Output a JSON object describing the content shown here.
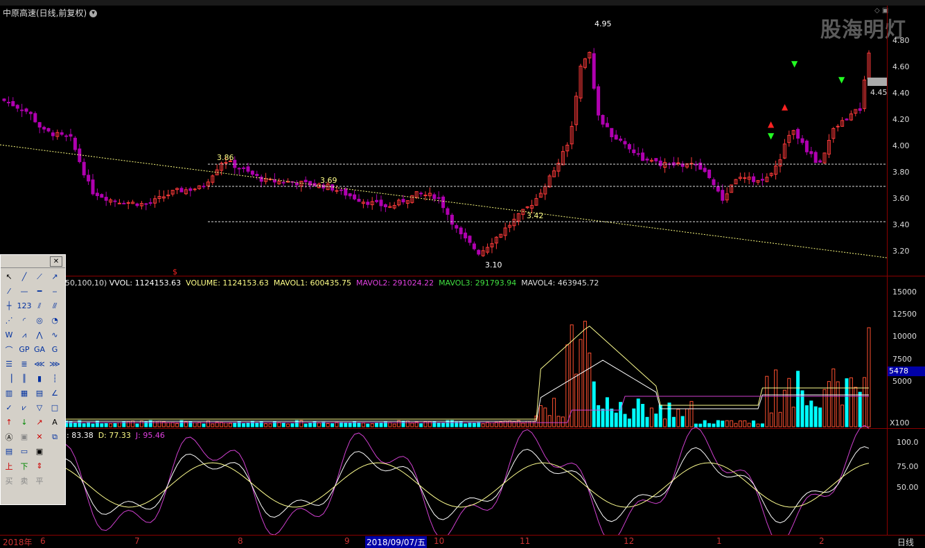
{
  "stock_title": "中原高速(日线,前复权)",
  "watermark": "股海明灯",
  "price_axis": [
    "4.80",
    "4.60",
    "4.40",
    "4.20",
    "4.00",
    "3.80",
    "3.60",
    "3.40",
    "3.20"
  ],
  "current_price": "4.45",
  "annotations": {
    "high": "4.95",
    "low": "3.10",
    "p1": "3.86",
    "p2": "3.69",
    "p3": "3.42"
  },
  "volume_header": {
    "params": "50,100,10)",
    "vvol": "VVOL: 1124153.63",
    "volume": "VOLUME: 1124153.63",
    "mavol1": "MAVOL1: 600435.75",
    "mavol2": "MAVOL2: 291024.22",
    "mavol3": "MAVOL3: 291793.94",
    "mavol4": "MAVOL4: 463945.72"
  },
  "volume_axis": [
    "15000",
    "12500",
    "10000",
    "7500",
    "5000"
  ],
  "volume_current": "5478",
  "volume_unit": "X100",
  "kdj_header": {
    "k": ": 83.38",
    "d": "D: 77.33",
    "j": "J: 95.46"
  },
  "kdj_axis": [
    "100.0",
    "75.00",
    "50.00"
  ],
  "bottom_dates": [
    "2018年",
    "6",
    "7",
    "8",
    "9",
    "10",
    "11",
    "12",
    "1",
    "2"
  ],
  "selected_date": "2018/09/07/五",
  "period": "日线",
  "toolbox_labels": [
    "123",
    "GP",
    "GA",
    "G",
    "上",
    "下",
    "A",
    "买",
    "卖",
    "平"
  ],
  "colors": {
    "up": "#ff3a3a",
    "down": "#b000b0",
    "vol_up": "#ff5030",
    "vol_down": "#00ffff",
    "grid": "#8b0000"
  }
}
